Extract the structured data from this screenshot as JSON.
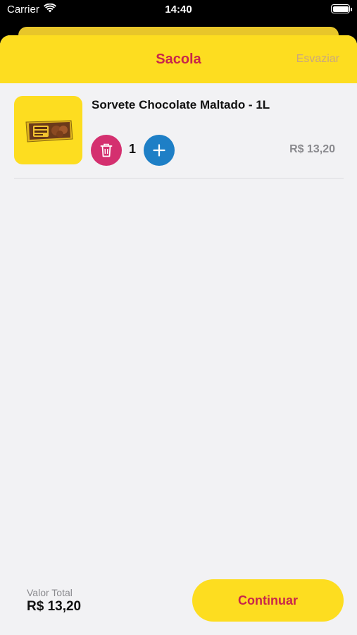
{
  "status_bar": {
    "carrier": "Carrier",
    "time": "14:40",
    "icons": [
      "wifi-icon",
      "battery-icon"
    ]
  },
  "header": {
    "title": "Sacola",
    "clear_label": "Esvaziar"
  },
  "cart": {
    "items": [
      {
        "name": "Sorvete Chocolate Maltado - 1L",
        "quantity": "1",
        "price": "R$ 13,20",
        "image_icon": "ice-cream-package-icon"
      }
    ]
  },
  "footer": {
    "total_label": "Valor Total",
    "total_value": "R$ 13,20",
    "continue_label": "Continuar"
  },
  "colors": {
    "brand_yellow": "#FDDD20",
    "accent_red": "#C8274A",
    "remove_pink": "#D4306F",
    "add_blue": "#1E7FC6",
    "muted_text": "#8A8A8E"
  }
}
